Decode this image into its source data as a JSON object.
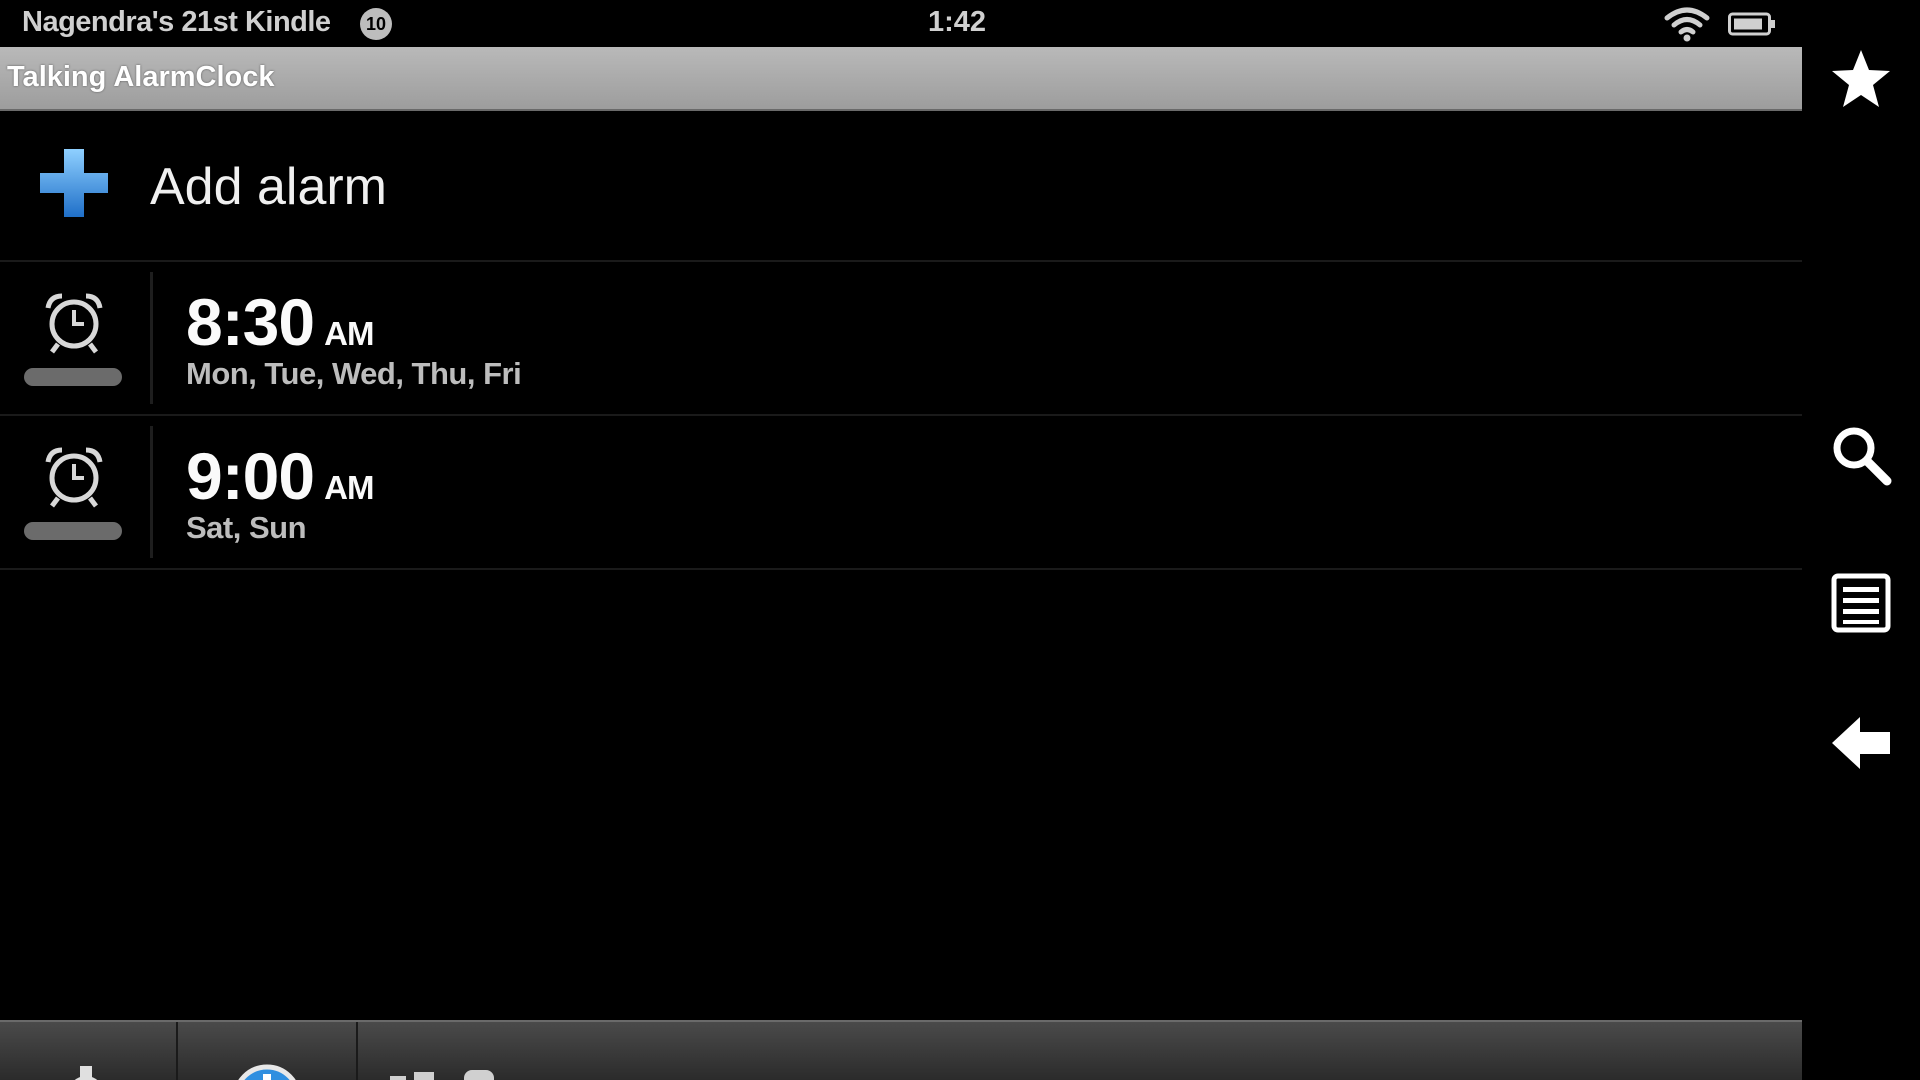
{
  "status_bar": {
    "device_name": "Nagendra's 21st Kindle",
    "notification_count": "10",
    "time": "1:42",
    "icons": [
      "wifi-icon",
      "battery-icon"
    ]
  },
  "app": {
    "title": "Talking AlarmClock"
  },
  "add_alarm": {
    "label": "Add alarm",
    "icon": "plus-icon",
    "accent": "#2f8fe0"
  },
  "alarms": [
    {
      "time": "8:30",
      "ampm": "AM",
      "days": "Mon, Tue, Wed, Thu, Fri",
      "icon": "alarm-clock-icon"
    },
    {
      "time": "9:00",
      "ampm": "AM",
      "days": "Sat, Sun",
      "icon": "alarm-clock-icon"
    }
  ],
  "nav_bar": {
    "buttons": [
      "star-icon",
      "search-icon",
      "menu-icon",
      "back-arrow-icon"
    ]
  },
  "bottom_toolbar": {
    "icons": [
      "gear-icon",
      "info-icon"
    ]
  }
}
